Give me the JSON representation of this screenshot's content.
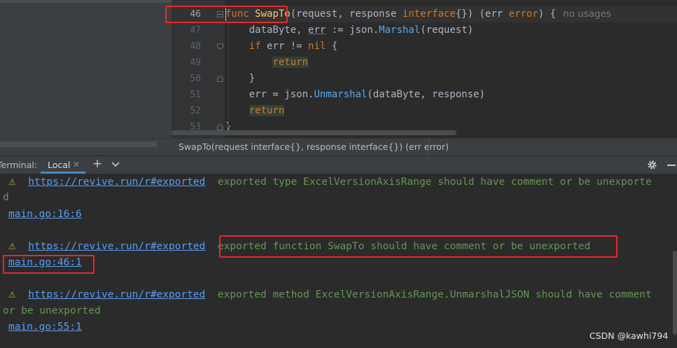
{
  "editor": {
    "lines": [
      {
        "num": "46",
        "current": true
      },
      {
        "num": "47"
      },
      {
        "num": "48"
      },
      {
        "num": "49"
      },
      {
        "num": "50"
      },
      {
        "num": "51"
      },
      {
        "num": "52"
      },
      {
        "num": "53"
      }
    ],
    "code": {
      "l46_kw": "func",
      "l46_name": "SwapTo",
      "l46_params": "(request, response ",
      "l46_type": "interface",
      "l46_rest": "{}) (err ",
      "l46_err": "error",
      "l46_end": ") {",
      "l46_hint": "no usages",
      "l47_a": "dataByte, ",
      "l47_err": "err",
      "l47_b": " := json.",
      "l47_fn": "Marshal",
      "l47_c": "(request)",
      "l48_kw": "if",
      "l48_a": " err != ",
      "l48_nil": "nil",
      "l48_b": " {",
      "l49_ret": "return",
      "l50": "}",
      "l51_a": "err = json.",
      "l51_fn": "Unmarshal",
      "l51_b": "(dataByte, response)",
      "l52_ret": "return",
      "l53": "}"
    }
  },
  "breadcrumb": "SwapTo(request interface{}, response interface{}) (err error)",
  "terminal": {
    "label": "Terminal:",
    "tab": "Local",
    "tab_close": "✕",
    "add": "+",
    "output": [
      {
        "link": "https://revive.run/r#exported",
        "msg": "exported type ExcelVersionAxisRange should have comment or be unexporte",
        "cont": "d",
        "loc": "main.go:16:6"
      },
      {
        "link": "https://revive.run/r#exported",
        "msg": "exported function SwapTo should have comment or be unexported",
        "loc": "main.go:46:1"
      },
      {
        "link": "https://revive.run/r#exported",
        "msg": "exported method ExcelVersionAxisRange.UnmarshalJSON should have comment",
        "cont": "or be unexported",
        "loc": "main.go:55:1"
      }
    ]
  },
  "watermark": "CSDN @kawhi794",
  "colors": {
    "accent": "#4a88c7",
    "annotation": "#e8282b",
    "link": "#589df6",
    "warning_text": "#629755"
  }
}
